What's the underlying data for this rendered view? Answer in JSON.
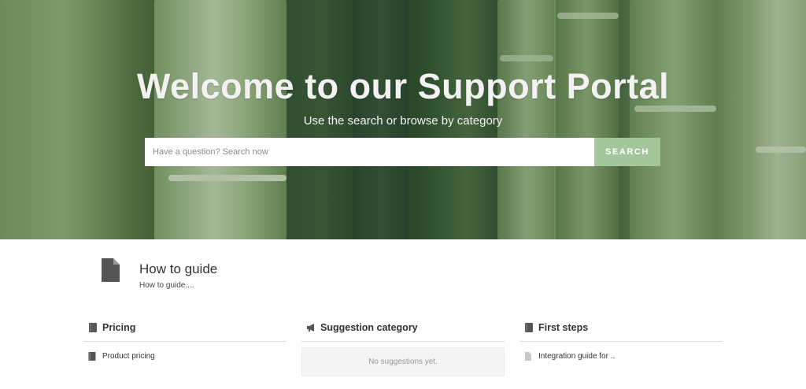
{
  "hero": {
    "title": "Welcome to our Support Portal",
    "subtitle": "Use the search or browse by category",
    "search_placeholder": "Have a question? Search now",
    "search_button": "SEARCH",
    "accent_color": "#a3c79a"
  },
  "featured": {
    "icon": "document-icon",
    "title": "How to guide",
    "description": "How to guide...."
  },
  "columns": [
    {
      "icon": "book-icon",
      "title": "Pricing",
      "items": [
        {
          "icon": "book-icon",
          "label": "Product pricing"
        }
      ]
    },
    {
      "icon": "megaphone-icon",
      "title": "Suggestion category",
      "empty_text": "No suggestions yet."
    },
    {
      "icon": "book-icon",
      "title": "First steps",
      "items": [
        {
          "icon": "document-icon",
          "label": "Integration guide for .."
        }
      ]
    }
  ]
}
